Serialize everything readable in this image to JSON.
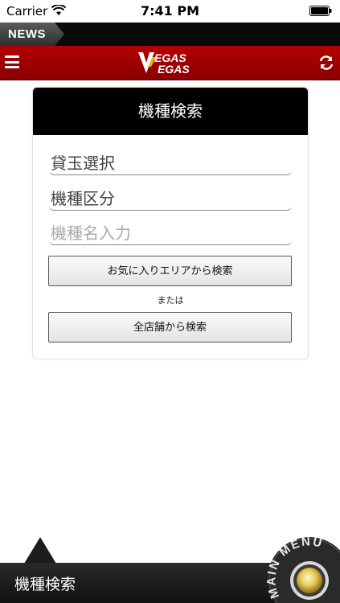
{
  "status_bar": {
    "carrier": "Carrier",
    "time": "7:41 PM"
  },
  "news": {
    "label": "NEWS"
  },
  "header": {
    "logo_line1": "EGAS",
    "logo_line2": "EGAS",
    "logo_letter": "V"
  },
  "search": {
    "title": "機種検索",
    "field_ball": "貸玉選択",
    "field_category": "機種区分",
    "field_name_placeholder": "機種名入力",
    "button_favorites": "お気に入りエリアから検索",
    "or_label": "または",
    "button_all_stores": "全店舗から検索"
  },
  "bottom": {
    "title": "機種検索",
    "main_menu_label": "MAIN MENU"
  },
  "colors": {
    "header_red": "#a00000",
    "black": "#000000"
  }
}
